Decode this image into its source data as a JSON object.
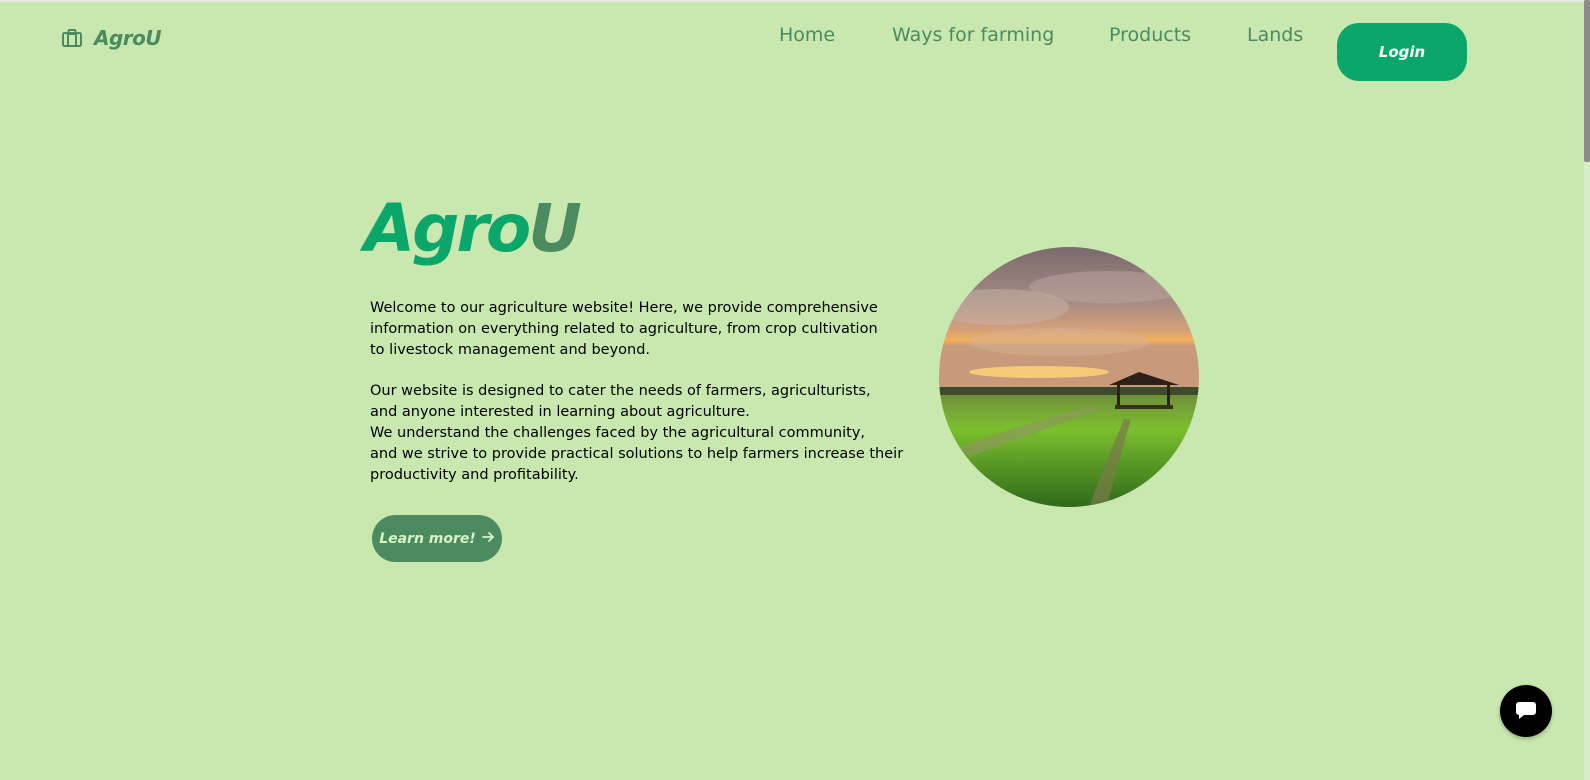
{
  "brand": {
    "name": "AgroU",
    "icon": "briefcase-icon"
  },
  "nav": {
    "items": [
      {
        "label": "Home"
      },
      {
        "label": "Ways for farming"
      },
      {
        "label": "Products"
      },
      {
        "label": "Lands"
      }
    ],
    "login_label": "Login"
  },
  "hero": {
    "title_part1": "Agro",
    "title_part2": "U",
    "paragraph1": "Welcome to our agriculture website! Here, we provide comprehensive\ninformation on everything related to agriculture, from crop cultivation\nto livestock management and beyond.",
    "paragraph2": "Our website is designed to cater the needs of farmers, agriculturists,\nand anyone interested in learning about agriculture.\nWe understand the challenges faced by the agricultural community,\nand we strive to provide practical solutions to help farmers increase their\nproductivity and profitability.",
    "button_label": "Learn more!",
    "button_icon": "arrow-right-icon",
    "image": "farm-field-sunset-image"
  },
  "chat": {
    "icon": "chat-bubble-icon"
  },
  "colors": {
    "background": "#c8e8b0",
    "primary": "#0aa66a",
    "secondary": "#4c8a5f"
  }
}
